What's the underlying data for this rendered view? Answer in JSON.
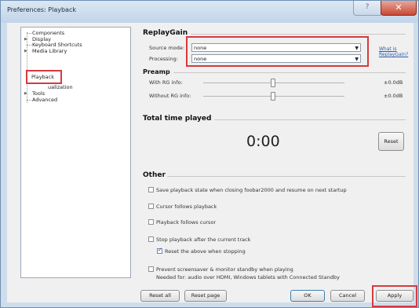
{
  "window": {
    "title": "Preferences: Playback",
    "help_glyph": "?",
    "close_glyph": "✕"
  },
  "tree": {
    "items": [
      {
        "label": "Components"
      },
      {
        "label": "Display"
      },
      {
        "label": "Keyboard Shortcuts"
      },
      {
        "label": "Media Library"
      },
      {
        "label": "Playback"
      },
      {
        "label": "Visualization",
        "visible_fragment": "ualization"
      },
      {
        "label": "Tools"
      },
      {
        "label": "Advanced"
      }
    ]
  },
  "replaygain": {
    "heading": "ReplayGain",
    "source_mode_label": "Source mode:",
    "source_mode_value": "none",
    "processing_label": "Processing:",
    "processing_value": "none",
    "link_line1": "What is",
    "link_line2": "ReplayGain?"
  },
  "preamp": {
    "heading": "Preamp",
    "with_rg_label": "With RG info:",
    "with_rg_value": "±0.0dB",
    "without_rg_label": "Without RG info:",
    "without_rg_value": "±0.0dB"
  },
  "total_time": {
    "heading": "Total time played",
    "value": "0:00",
    "reset_label": "Reset"
  },
  "other": {
    "heading": "Other",
    "save_state_label": "Save playback state when closing foobar2000 and resume on next startup",
    "cursor_follows_playback_label": "Cursor follows playback",
    "playback_follows_cursor_label": "Playback follows cursor",
    "stop_after_current_label": "Stop playback after the current track",
    "reset_above_label": "Reset the above when stopping",
    "prevent_standby_label": "Prevent screensaver & monitor standby when playing",
    "prevent_standby_note": "Needed for: audio over HDMI, Windows tablets with Connected Standby",
    "checks": {
      "save_state": false,
      "cursor_follows_playback": false,
      "playback_follows_cursor": false,
      "stop_after_current": false,
      "reset_above": true,
      "prevent_standby": false
    }
  },
  "buttons": {
    "reset_all": "Reset all",
    "reset_page": "Reset page",
    "ok": "OK",
    "cancel": "Cancel",
    "apply": "Apply"
  },
  "colors": {
    "highlight": "#d7393f",
    "link": "#2a5db0"
  }
}
